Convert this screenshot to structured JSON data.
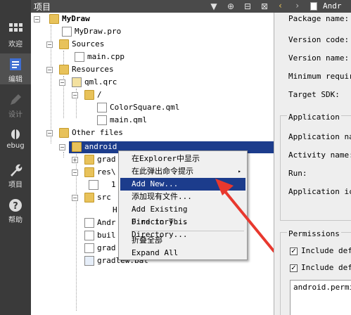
{
  "modes": [
    {
      "label": "欢迎",
      "icon": "grid-icon"
    },
    {
      "label": "编辑",
      "icon": "edit-document-icon"
    },
    {
      "label": "设计",
      "icon": "pencil-icon"
    },
    {
      "label": "ebug",
      "icon": "bug-icon"
    },
    {
      "label": "项目",
      "icon": "wrench-icon"
    },
    {
      "label": "帮助",
      "icon": "help-icon"
    }
  ],
  "project_header": {
    "title": "项目",
    "buttons": [
      "filter-icon",
      "link-icon",
      "split-icon",
      "close-icon"
    ]
  },
  "tree": {
    "rows": [
      {
        "label": "MyDraw"
      },
      {
        "label": "MyDraw.pro"
      },
      {
        "label": "Sources"
      },
      {
        "label": "main.cpp"
      },
      {
        "label": "Resources"
      },
      {
        "label": "qml.qrc"
      },
      {
        "label": "/"
      },
      {
        "label": "ColorSquare.qml"
      },
      {
        "label": "main.qml"
      },
      {
        "label": "Other files"
      },
      {
        "label": "android"
      },
      {
        "label": "grad"
      },
      {
        "label": "res\\"
      },
      {
        "label": "1"
      },
      {
        "label": "src"
      },
      {
        "label": "H"
      },
      {
        "label": "Andr"
      },
      {
        "label": "buil"
      },
      {
        "label": "grad"
      },
      {
        "label": "gradlew.bat"
      }
    ]
  },
  "context_menu": {
    "items": [
      {
        "label": "在Explorer中显示"
      },
      {
        "label": "在此弹出命令提示",
        "submenu": "▸"
      },
      {
        "label": "Add New..."
      },
      {
        "label": "添加现有文件..."
      },
      {
        "label": "Add Existing Directory..."
      },
      {
        "label": "Find in This Directory..."
      },
      {
        "label": "折叠全部"
      },
      {
        "label": "Expand All"
      }
    ]
  },
  "right_panel": {
    "tab": "Andr",
    "fields": [
      "Package name:",
      "Version code:",
      "Version name:",
      "Minimum require",
      "Target SDK:"
    ],
    "application": {
      "title": "Application",
      "fields": [
        "Application nam",
        "Activity name:",
        "Run:",
        "Application ico"
      ]
    },
    "permissions": {
      "title": "Permissions",
      "checks": [
        {
          "label": "Include defa",
          "checked": true
        },
        {
          "label": "Include defa",
          "checked": true
        }
      ],
      "list_text": "android.permis"
    }
  },
  "colors": {
    "selection": "#1c3c8c",
    "arrow": "#e8382e",
    "modebar": "#3a3a3a"
  }
}
